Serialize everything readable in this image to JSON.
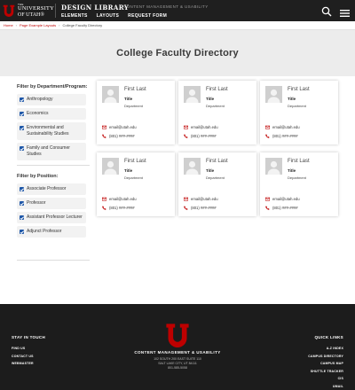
{
  "header": {
    "logo": {
      "the": "THE",
      "university": "UNIVERSITY",
      "of_utah": "OF UTAH®"
    },
    "site_title": "DESIGN LIBRARY",
    "site_subtitle": "CONTENT MANAGEMENT & USABILITY",
    "nav": [
      "ELEMENTS",
      "LAYOUTS",
      "REQUEST FORM"
    ],
    "icons": {
      "search": "search-icon",
      "menu": "menu-icon"
    }
  },
  "breadcrumb": {
    "home": "Home",
    "layouts": "Page Example Layouts",
    "current": "College Faculty Directory",
    "separator": "›"
  },
  "page_title": "College Faculty Directory",
  "filters": {
    "department": {
      "heading": "Filter by Department/Program:",
      "items": [
        "Anthropology",
        "Economics",
        "Environmental and Sustainability Studies",
        "Family and Consumer Studies"
      ]
    },
    "position": {
      "heading": "Filter by Position:",
      "items": [
        "Associate Professor",
        "Professor",
        "Assistant Professor Lecturer",
        "Adjunct Professor"
      ]
    }
  },
  "cards": [
    {
      "name": "First Last",
      "title": "Title",
      "department": "Department",
      "email": "email@utah.edu",
      "phone": "(801) ###-####"
    },
    {
      "name": "First Last",
      "title": "Title",
      "department": "Department",
      "email": "email@utah.edu",
      "phone": "(801) ###-####"
    },
    {
      "name": "First Last",
      "title": "Title",
      "department": "Department",
      "email": "email@utah.edu",
      "phone": "(801) ###-####"
    },
    {
      "name": "First Last",
      "title": "Title",
      "department": "Department",
      "email": "email@utah.edu",
      "phone": "(801) ###-####"
    },
    {
      "name": "First Last",
      "title": "Title",
      "department": "Department",
      "email": "email@utah.edu",
      "phone": "(801) ###-####"
    },
    {
      "name": "First Last",
      "title": "Title",
      "department": "Department",
      "email": "email@utah.edu",
      "phone": "(801) ###-####"
    }
  ],
  "footer": {
    "stay_in_touch": {
      "heading": "STAY IN TOUCH",
      "links": [
        "FIND US",
        "CONTACT US",
        "WEBMASTER"
      ]
    },
    "org_name": "CONTENT MANAGEMENT & USABILITY",
    "address": [
      "102 SOUTH 200 EAST SUITE 110",
      "SALT LAKE CITY, UT 84111",
      "801-585-5058"
    ],
    "quick_links": {
      "heading": "QUICK LINKS",
      "links": [
        "A-Z INDEX",
        "CAMPUS DIRECTORY",
        "CAMPUS MAP",
        "SHUTTLE TRACKER",
        "CIS",
        "UMAIL"
      ]
    }
  },
  "colors": {
    "brand_red": "#be0000",
    "header_bg": "#1f1f1f",
    "footer_bg": "#1c1c1c",
    "checkbox_blue": "#1e57a8"
  }
}
